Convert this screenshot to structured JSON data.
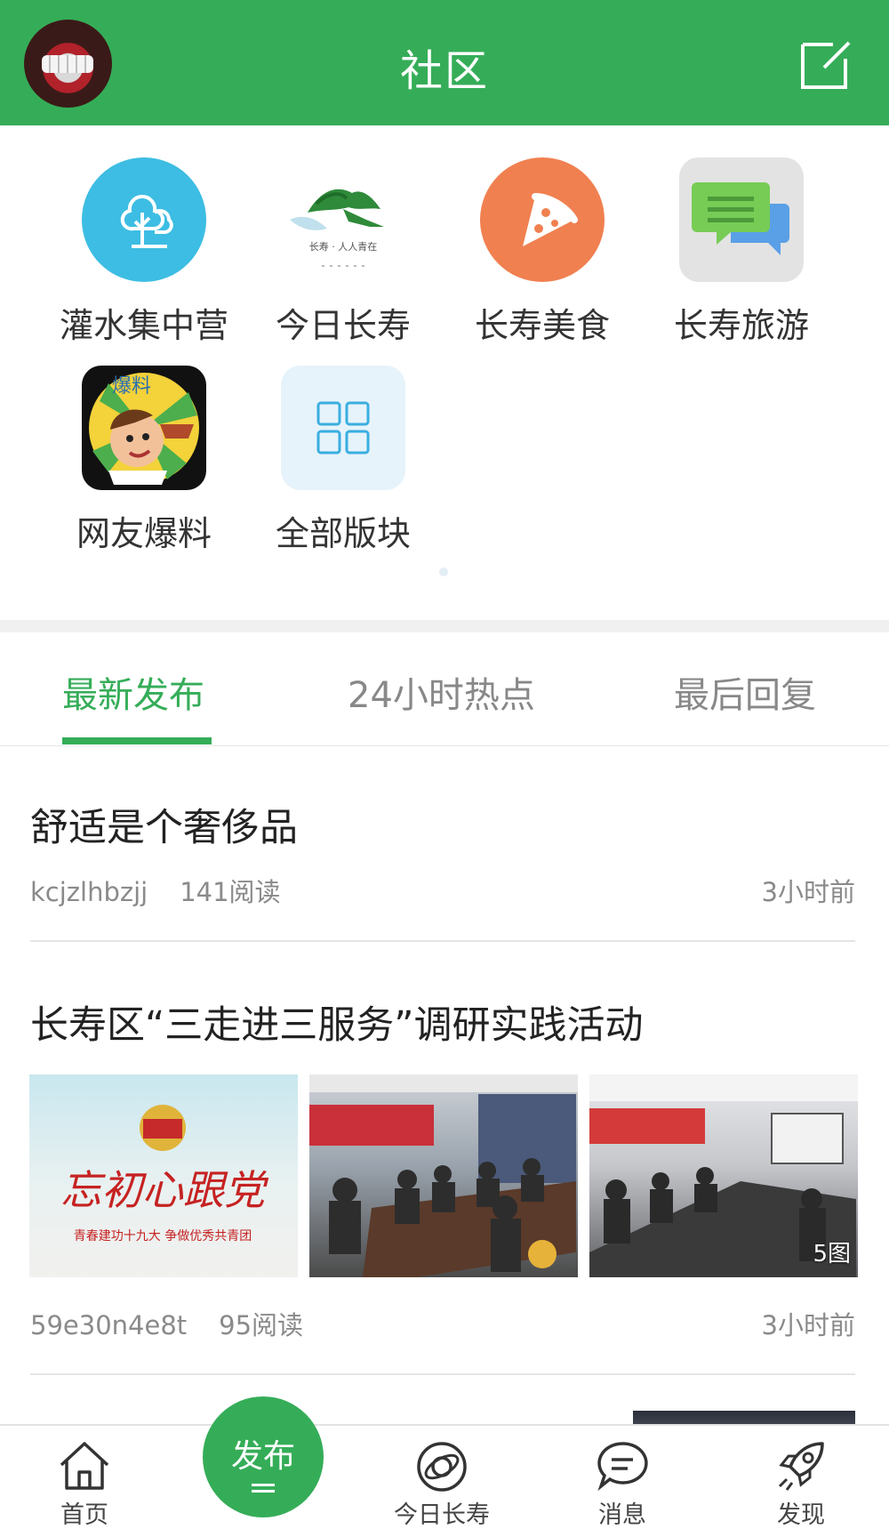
{
  "header": {
    "title": "社区"
  },
  "boards": [
    {
      "label": "灌水集中营",
      "icon": "tree-icon"
    },
    {
      "label": "今日长寿",
      "icon": "jinri-changshou-logo",
      "logo_text": "长寿 · 人人青在"
    },
    {
      "label": "长寿美食",
      "icon": "pizza-icon"
    },
    {
      "label": "长寿旅游",
      "icon": "chat-bubbles-icon"
    },
    {
      "label": "网友爆料",
      "icon": "baoliao-chef-icon",
      "logo_text": "爆料"
    },
    {
      "label": "全部版块",
      "icon": "grid-icon"
    }
  ],
  "tabs": [
    {
      "label": "最新发布",
      "active": true
    },
    {
      "label": "24小时热点",
      "active": false
    },
    {
      "label": "最后回复",
      "active": false
    }
  ],
  "posts": [
    {
      "title": "舒适是个奢侈品",
      "author": "kcjzlhbzjj",
      "reads": "141阅读",
      "time": "3小时前"
    },
    {
      "title": "长寿区“三走进三服务”调研实践活动",
      "author": "59e30n4e8t",
      "reads": "95阅读",
      "time": "3小时前",
      "images": [
        {
          "desc": "banner",
          "text1": "忘初心跟党",
          "text2": "青春建功十九大 争做优秀共青团"
        },
        {
          "desc": "meeting-room"
        },
        {
          "desc": "meeting-room",
          "badge": "5图"
        }
      ]
    }
  ],
  "tabbar": {
    "items": [
      {
        "label": "首页",
        "icon": "home-icon"
      },
      {
        "label": "发布",
        "icon": "publish-button"
      },
      {
        "label": "今日长寿",
        "icon": "planet-icon"
      },
      {
        "label": "消息",
        "icon": "message-icon"
      },
      {
        "label": "发现",
        "icon": "rocket-icon"
      }
    ]
  },
  "colors": {
    "brand_green": "#35ad58",
    "muted_text": "#8a8a8a"
  }
}
